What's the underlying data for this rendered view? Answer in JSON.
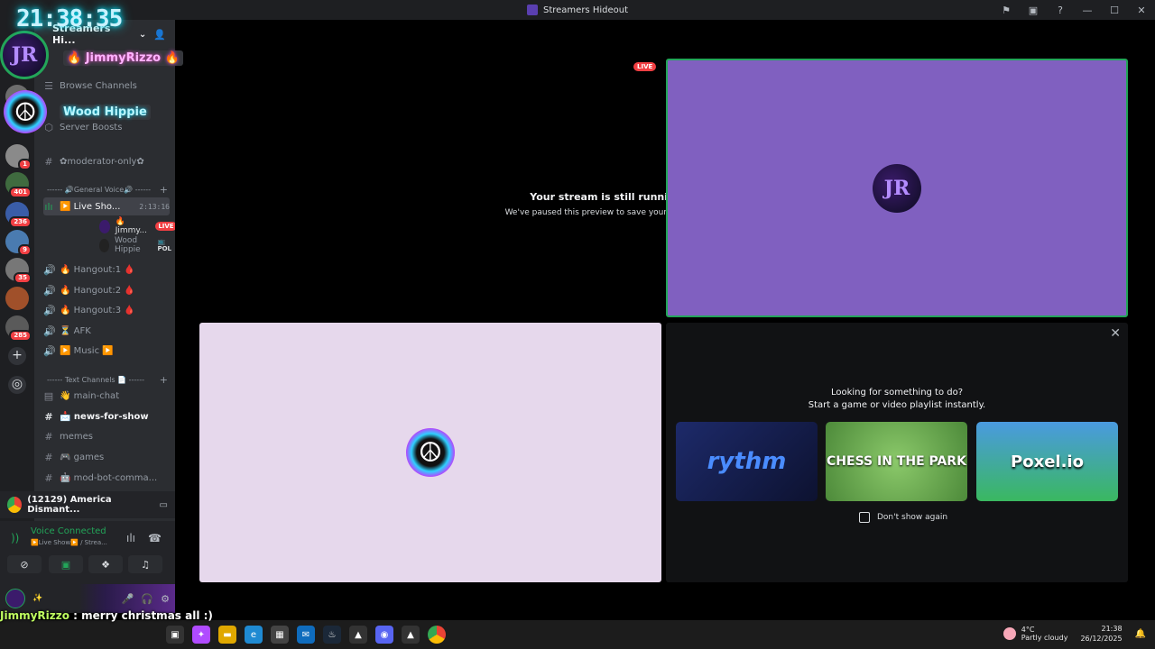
{
  "window": {
    "title": "Streamers Hideout"
  },
  "overlay": {
    "clock": "21:38:35",
    "jimmy_name": "🔥 JimmyRizzo 🔥",
    "wood_name": "Wood Hippie"
  },
  "server": {
    "name": "Streamers Hi..."
  },
  "guild_badges": [
    "1",
    "401",
    "236",
    "9",
    "35",
    "285"
  ],
  "sidebar": {
    "browse_channels": "Browse Channels",
    "server_boosts": "Server Boosts",
    "moderator_only": "✿moderator-only✿",
    "cat_voice": "------ 🔊General Voice🔊 ------",
    "live_show": "▶️ Live Sho...",
    "live_timer": "2:13:16",
    "voice_user1": "🔥 Jimmy...",
    "voice_user1_badge": "LIVE",
    "voice_user2": "Wood Hippie",
    "voice_user2_badge": "📺 POL",
    "hangout1": "🔥 Hangout:1 🩸",
    "hangout2": "🔥 Hangout:2 🩸",
    "hangout3": "🔥 Hangout:3 🩸",
    "afk": "⏳ AFK",
    "music": "▶️ Music ▶️",
    "cat_text": "------ Text Channels 📄 ------",
    "main_chat": "👋 main-chat",
    "news": "📩 news-for-show",
    "memes": "memes",
    "games": "🎮 games",
    "mod_bot": "🤖 mod-bot-comma..."
  },
  "activity_bar": {
    "text": "(12129) America Dismant..."
  },
  "voice_panel": {
    "status": "Voice Connected",
    "sub": "▶️Live Show▶️ / Strea..."
  },
  "chat_overlay": {
    "name": "JimmyRizzo",
    "message": " : merry christmas all :)"
  },
  "stage": {
    "paused_title": "Your stream is still running!",
    "paused_sub": "We've paused this preview to save your resources.",
    "live_badge": "LIVE",
    "activity_q1": "Looking for something to do?",
    "activity_q2": "Start a game or video playlist instantly.",
    "games": [
      "rythm",
      "CHESS IN THE PARK",
      "Poxel.io"
    ],
    "dont_show": "Don't show again"
  },
  "taskbar": {
    "temp": "4°C",
    "weather": "Partly cloudy",
    "time": "21:38",
    "date": "26/12/2025"
  }
}
